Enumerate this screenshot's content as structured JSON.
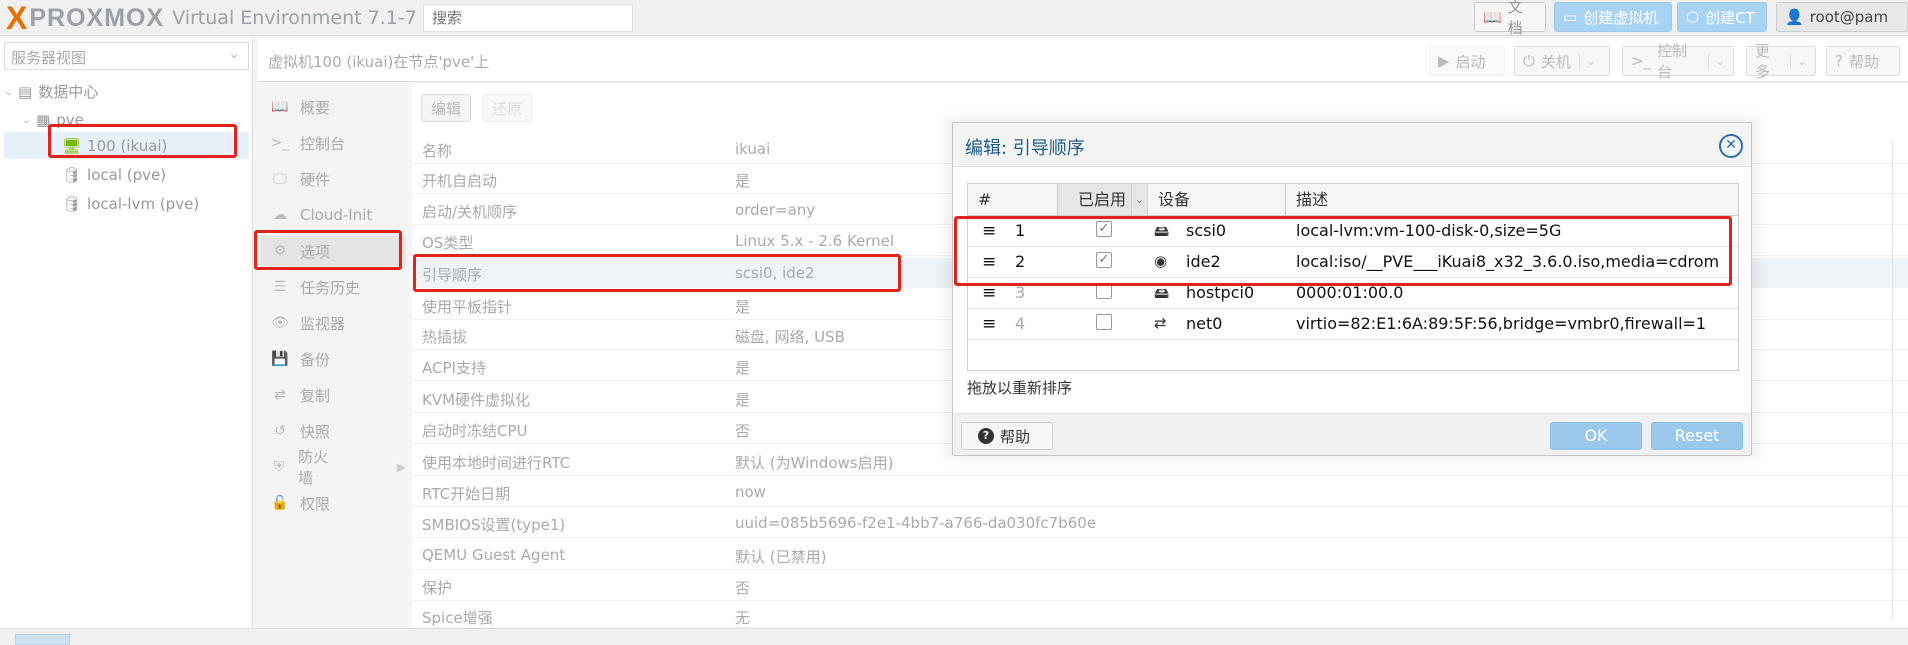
{
  "header": {
    "logo_x": "X",
    "logo_name": "PROXMOX",
    "version": "Virtual Environment 7.1-7",
    "search_placeholder": "搜索",
    "docs_label": "文档",
    "create_vm_label": "创建虚拟机",
    "create_ct_label": "创建CT",
    "user_label": "root@pam"
  },
  "tree": {
    "view_label": "服务器视图",
    "items": [
      {
        "label": "数据中心",
        "icon": "server-rack-icon"
      },
      {
        "label": "pve",
        "icon": "node-icon"
      },
      {
        "label": "100 (ikuai)",
        "icon": "vm-running-icon"
      },
      {
        "label": "local (pve)",
        "icon": "storage-icon"
      },
      {
        "label": "local-lvm (pve)",
        "icon": "storage-icon"
      }
    ]
  },
  "vm": {
    "title": "虚拟机100 (ikuai)在节点'pve'上",
    "start_label": "启动",
    "shutdown_label": "关机",
    "console_label": "控制台",
    "more_label": "更多",
    "help_label": "帮助"
  },
  "nav": {
    "items": [
      {
        "label": "概要"
      },
      {
        "label": "控制台"
      },
      {
        "label": "硬件"
      },
      {
        "label": "Cloud-Init"
      },
      {
        "label": "选项"
      },
      {
        "label": "任务历史"
      },
      {
        "label": "监视器"
      },
      {
        "label": "备份"
      },
      {
        "label": "复制"
      },
      {
        "label": "快照"
      },
      {
        "label": "防火墙"
      },
      {
        "label": "权限"
      }
    ]
  },
  "options": {
    "edit_label": "编辑",
    "revert_label": "还原",
    "rows": [
      {
        "key": "名称",
        "value": "ikuai"
      },
      {
        "key": "开机自启动",
        "value": "是"
      },
      {
        "key": "启动/关机顺序",
        "value": "order=any"
      },
      {
        "key": "OS类型",
        "value": "Linux 5.x - 2.6 Kernel"
      },
      {
        "key": "引导顺序",
        "value": "scsi0, ide2"
      },
      {
        "key": "使用平板指针",
        "value": "是"
      },
      {
        "key": "热插拔",
        "value": "磁盘, 网络, USB"
      },
      {
        "key": "ACPI支持",
        "value": "是"
      },
      {
        "key": "KVM硬件虚拟化",
        "value": "是"
      },
      {
        "key": "启动时冻结CPU",
        "value": "否"
      },
      {
        "key": "使用本地时间进行RTC",
        "value": "默认 (为Windows启用)"
      },
      {
        "key": "RTC开始日期",
        "value": "now"
      },
      {
        "key": "SMBIOS设置(type1)",
        "value": "uuid=085b5696-f2e1-4bb7-a766-da030fc7b60e"
      },
      {
        "key": "QEMU Guest Agent",
        "value": "默认 (已禁用)"
      },
      {
        "key": "保护",
        "value": "否"
      },
      {
        "key": "Spice增强",
        "value": "无"
      }
    ]
  },
  "dialog": {
    "title": "编辑: 引导顺序",
    "columns": {
      "num": "#",
      "enabled": "已启用",
      "device": "设备",
      "desc": "描述"
    },
    "rows": [
      {
        "num": "1",
        "enabled": true,
        "device": "scsi0",
        "icon": "disk-icon",
        "icon_glyph": "🖴",
        "desc": "local-lvm:vm-100-disk-0,size=5G"
      },
      {
        "num": "2",
        "enabled": true,
        "device": "ide2",
        "icon": "cdrom-icon",
        "icon_glyph": "◉",
        "desc": "local:iso/__PVE___iKuai8_x32_3.6.0.iso,media=cdrom"
      },
      {
        "num": "3",
        "enabled": false,
        "device": "hostpci0",
        "icon": "disk-icon",
        "icon_glyph": "🖴",
        "desc": "0000:01:00.0"
      },
      {
        "num": "4",
        "enabled": false,
        "device": "net0",
        "icon": "network-arrows-icon",
        "icon_glyph": "⇄",
        "desc": "virtio=82:E1:6A:89:5F:56,bridge=vmbr0,firewall=1"
      }
    ],
    "drag_hint": "拖放以重新排序",
    "help_label": "帮助",
    "ok_label": "OK",
    "reset_label": "Reset"
  },
  "colors": {
    "accent": "#e57000",
    "highlight": "#e2231a",
    "button_blue": "#9cc8ec"
  }
}
